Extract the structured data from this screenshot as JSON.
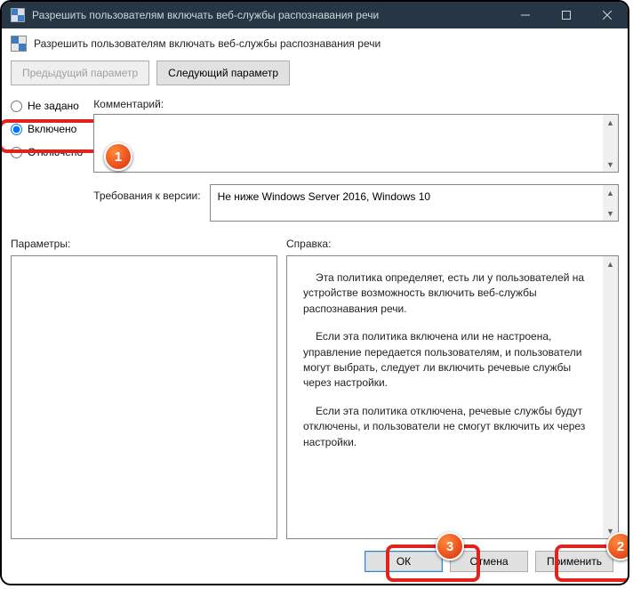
{
  "titlebar": {
    "title": "Разрешить пользователям включать веб-службы распознавания речи"
  },
  "header": {
    "caption": "Разрешить пользователям включать веб-службы распознавания речи"
  },
  "nav": {
    "prev": "Предыдущий параметр",
    "next": "Следующий параметр"
  },
  "radios": {
    "not_configured": "Не задано",
    "enabled": "Включено",
    "disabled": "Отключено"
  },
  "labels": {
    "comment": "Комментарий:",
    "requirements": "Требования к версии:",
    "parameters": "Параметры:",
    "help": "Справка:"
  },
  "requirements": {
    "text": "Не ниже Windows Server 2016, Windows 10"
  },
  "help": {
    "p1": "Эта политика определяет, есть ли у пользователей на устройстве возможность включить веб-службы распознавания речи.",
    "p2": "Если эта политика включена или не настроена, управление передается пользователям, и пользователи могут выбрать, следует ли включить речевые службы через настройки.",
    "p3": "Если эта политика отключена, речевые службы будут отключены, и пользователи не смогут включить их через настройки."
  },
  "footer": {
    "ok": "ОК",
    "cancel": "Отмена",
    "apply": "Применить"
  },
  "badges": {
    "b1": "1",
    "b2": "2",
    "b3": "3"
  }
}
